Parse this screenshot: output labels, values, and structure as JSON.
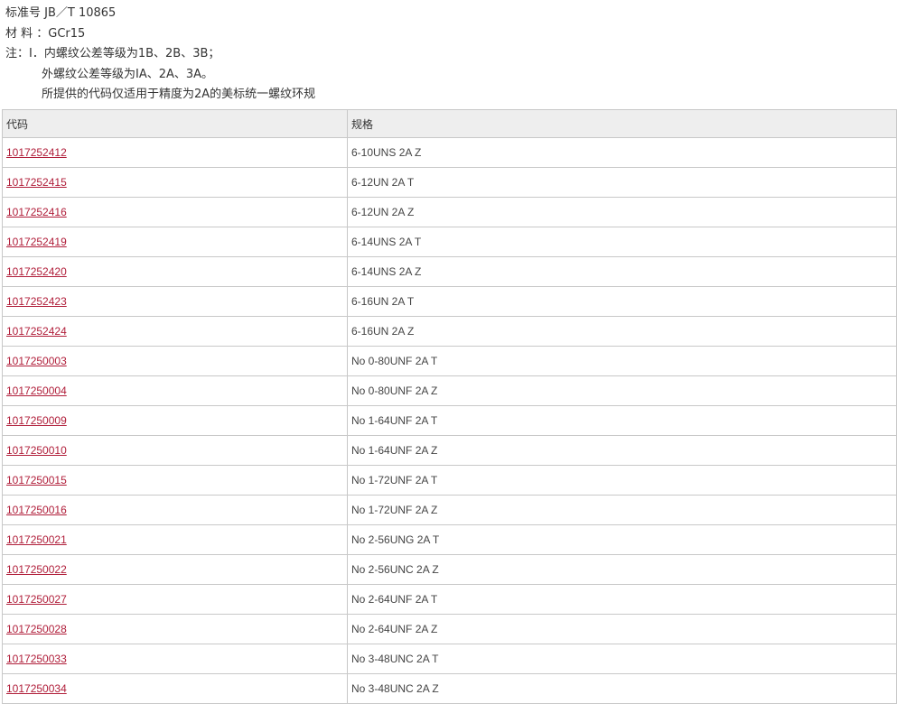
{
  "intro": {
    "standard": "标准号 JB／T 10865",
    "material": "材 料 ：GCr15",
    "note_line1": "注：I．内螺纹公差等级为1B、2B、3B；",
    "note_line2": "外螺纹公差等级为IA、2A、3A。",
    "note_line3": "所提供的代码仅适用于精度为2A的美标统一螺纹环规"
  },
  "table": {
    "headers": [
      "代码",
      "规格"
    ],
    "rows": [
      {
        "code": "1017252412",
        "spec": "6-10UNS 2A Z"
      },
      {
        "code": "1017252415",
        "spec": "6-12UN 2A T"
      },
      {
        "code": "1017252416",
        "spec": "6-12UN 2A Z"
      },
      {
        "code": "1017252419",
        "spec": "6-14UNS 2A T"
      },
      {
        "code": "1017252420",
        "spec": "6-14UNS 2A Z"
      },
      {
        "code": "1017252423",
        "spec": "6-16UN 2A T"
      },
      {
        "code": "1017252424",
        "spec": "6-16UN 2A Z"
      },
      {
        "code": "1017250003",
        "spec": "No 0-80UNF 2A T"
      },
      {
        "code": "1017250004",
        "spec": "No 0-80UNF 2A Z"
      },
      {
        "code": "1017250009",
        "spec": "No 1-64UNF 2A T"
      },
      {
        "code": "1017250010",
        "spec": "No 1-64UNF 2A Z"
      },
      {
        "code": "1017250015",
        "spec": "No 1-72UNF 2A T"
      },
      {
        "code": "1017250016",
        "spec": "No 1-72UNF 2A Z"
      },
      {
        "code": "1017250021",
        "spec": "No 2-56UNG 2A T"
      },
      {
        "code": "1017250022",
        "spec": "No 2-56UNC 2A Z"
      },
      {
        "code": "1017250027",
        "spec": "No 2-64UNF 2A T"
      },
      {
        "code": "1017250028",
        "spec": "No 2-64UNF 2A Z"
      },
      {
        "code": "1017250033",
        "spec": "No 3-48UNC 2A T"
      },
      {
        "code": "1017250034",
        "spec": "No 3-48UNC 2A Z"
      }
    ]
  },
  "colors": {
    "link": "#b01e3a",
    "header_bg": "#eeeeee",
    "border": "#c8c8c8"
  }
}
